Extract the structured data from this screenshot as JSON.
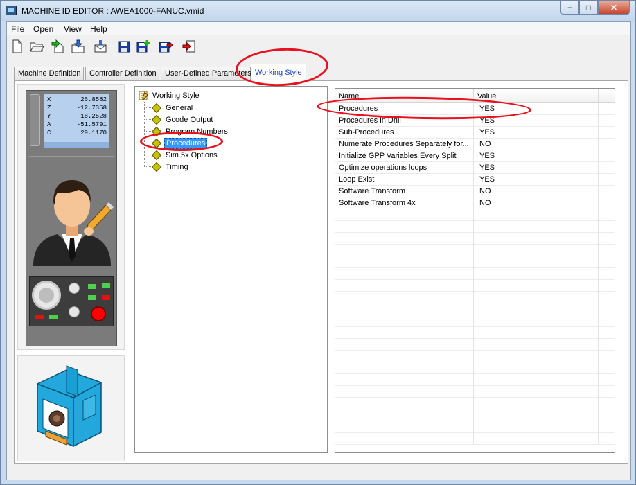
{
  "window": {
    "title": "MACHINE ID EDITOR : AWEA1000-FANUC.vmid",
    "min_glyph": "−",
    "max_glyph": "□",
    "close_glyph": "✕"
  },
  "menu": [
    "File",
    "Open",
    "View",
    "Help"
  ],
  "toolbar": {
    "icons": [
      "new-file-icon",
      "open-folder-icon",
      "import-icon",
      "open-download-icon",
      "email-icon",
      "save-icon",
      "save-add-icon",
      "save-as-icon",
      "exit-icon"
    ]
  },
  "tabs": [
    {
      "label": "Machine Definition",
      "active": false
    },
    {
      "label": "Controller Definition",
      "active": false
    },
    {
      "label": "User-Defined Parameters",
      "active": false
    },
    {
      "label": "Working Style",
      "active": true
    }
  ],
  "machine_screen": [
    {
      "axis": "X",
      "value": "26.8582"
    },
    {
      "axis": "Z",
      "value": "-12.7358"
    },
    {
      "axis": "Y",
      "value": "18.2528"
    },
    {
      "axis": "A",
      "value": "-51.5791"
    },
    {
      "axis": "C",
      "value": "29.1170"
    }
  ],
  "tree": {
    "root": "Working Style",
    "items": [
      {
        "label": "General",
        "selected": false
      },
      {
        "label": "Gcode Output",
        "selected": false
      },
      {
        "label": "Program Numbers",
        "selected": false
      },
      {
        "label": "Procedures",
        "selected": true
      },
      {
        "label": "Sim 5x Options",
        "selected": false
      },
      {
        "label": "Timing",
        "selected": false
      }
    ]
  },
  "grid": {
    "headers": {
      "name": "Name",
      "value": "Value"
    },
    "rows": [
      {
        "name": "Procedures",
        "value": "YES"
      },
      {
        "name": "Procedures in Drill",
        "value": "YES"
      },
      {
        "name": "Sub-Procedures",
        "value": "YES"
      },
      {
        "name": "Numerate Procedures Separately for...",
        "value": "NO"
      },
      {
        "name": "Initialize GPP Variables Every Split",
        "value": "YES"
      },
      {
        "name": "Optimize operations loops",
        "value": "YES"
      },
      {
        "name": "Loop Exist",
        "value": "YES"
      },
      {
        "name": "Software Transform",
        "value": "NO"
      },
      {
        "name": "Software Transform 4x",
        "value": "NO"
      },
      {
        "name": "",
        "value": ""
      },
      {
        "name": "",
        "value": ""
      },
      {
        "name": "",
        "value": ""
      },
      {
        "name": "",
        "value": ""
      },
      {
        "name": "",
        "value": ""
      },
      {
        "name": "",
        "value": ""
      },
      {
        "name": "",
        "value": ""
      },
      {
        "name": "",
        "value": ""
      },
      {
        "name": "",
        "value": ""
      },
      {
        "name": "",
        "value": ""
      },
      {
        "name": "",
        "value": ""
      },
      {
        "name": "",
        "value": ""
      },
      {
        "name": "",
        "value": ""
      },
      {
        "name": "",
        "value": ""
      },
      {
        "name": "",
        "value": ""
      },
      {
        "name": "",
        "value": ""
      },
      {
        "name": "",
        "value": ""
      },
      {
        "name": "",
        "value": ""
      },
      {
        "name": "",
        "value": ""
      },
      {
        "name": "",
        "value": ""
      }
    ]
  },
  "colors": {
    "selection": "#3399ff",
    "active_tab_text": "#1a3fb8",
    "annotation": "#e8121f"
  }
}
